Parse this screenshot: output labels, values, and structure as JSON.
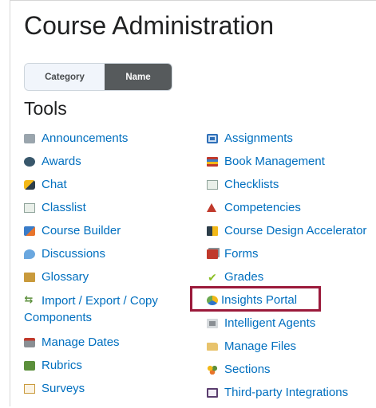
{
  "page": {
    "title": "Course Administration"
  },
  "toggle": {
    "category": "Category",
    "name": "Name",
    "active": "Name"
  },
  "tools": {
    "title": "Tools",
    "left": [
      {
        "label": "Announcements",
        "icon": "announcements-icon"
      },
      {
        "label": "Awards",
        "icon": "awards-icon"
      },
      {
        "label": "Chat",
        "icon": "chat-icon"
      },
      {
        "label": "Classlist",
        "icon": "classlist-icon"
      },
      {
        "label": "Course Builder",
        "icon": "course-builder-icon"
      },
      {
        "label": "Discussions",
        "icon": "discussions-icon"
      },
      {
        "label": "Glossary",
        "icon": "glossary-icon"
      },
      {
        "label": "Import / Export / Copy Components",
        "icon": "import-export-icon"
      },
      {
        "label": "Manage Dates",
        "icon": "manage-dates-icon"
      },
      {
        "label": "Rubrics",
        "icon": "rubrics-icon"
      },
      {
        "label": "Surveys",
        "icon": "surveys-icon"
      }
    ],
    "right": [
      {
        "label": "Assignments",
        "icon": "assignments-icon"
      },
      {
        "label": "Book Management",
        "icon": "book-management-icon"
      },
      {
        "label": "Checklists",
        "icon": "checklists-icon"
      },
      {
        "label": "Competencies",
        "icon": "competencies-icon"
      },
      {
        "label": "Course Design Accelerator",
        "icon": "course-design-accelerator-icon"
      },
      {
        "label": "Forms",
        "icon": "forms-icon"
      },
      {
        "label": "Grades",
        "icon": "grades-icon"
      },
      {
        "label": "Insights Portal",
        "icon": "insights-portal-icon"
      },
      {
        "label": "Intelligent Agents",
        "icon": "intelligent-agents-icon"
      },
      {
        "label": "Manage Files",
        "icon": "manage-files-icon"
      },
      {
        "label": "Sections",
        "icon": "sections-icon"
      },
      {
        "label": "Third-party Integrations",
        "icon": "third-party-integrations-icon"
      }
    ]
  },
  "colors": {
    "link": "#006fbf",
    "highlight": "#9b1a3b",
    "toggle_active": "#565a5c"
  }
}
